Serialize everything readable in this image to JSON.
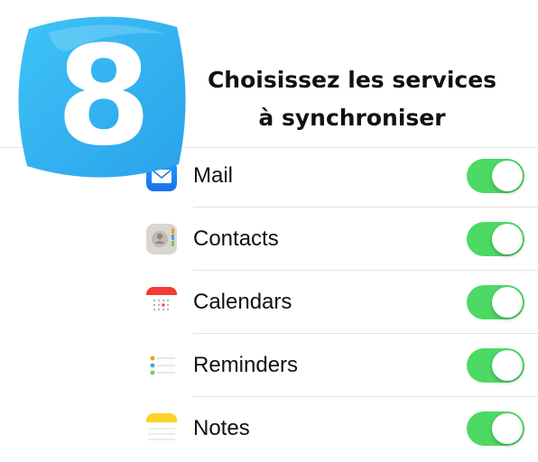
{
  "step": {
    "number": "8"
  },
  "title": {
    "line1": "Choisissez les services",
    "line2": "à synchroniser"
  },
  "colors": {
    "badge_blue": "#3bb6f0",
    "toggle_on": "#4cd964"
  },
  "services": [
    {
      "label": "Mail",
      "icon": "mail-icon",
      "enabled": true
    },
    {
      "label": "Contacts",
      "icon": "contacts-icon",
      "enabled": true
    },
    {
      "label": "Calendars",
      "icon": "calendar-icon",
      "enabled": true
    },
    {
      "label": "Reminders",
      "icon": "reminders-icon",
      "enabled": true
    },
    {
      "label": "Notes",
      "icon": "notes-icon",
      "enabled": true
    }
  ]
}
